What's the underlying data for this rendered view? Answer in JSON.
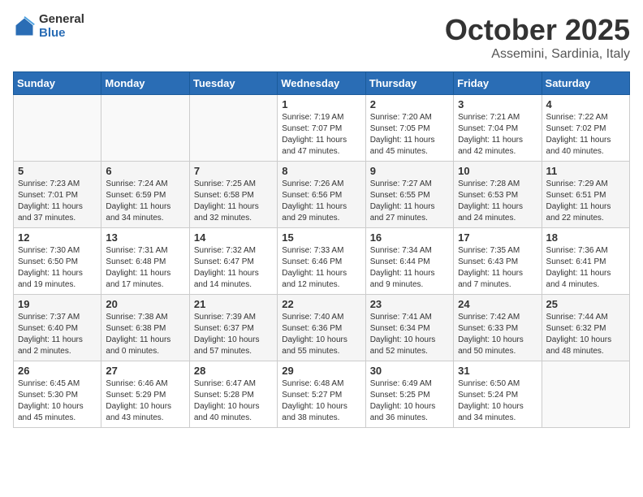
{
  "header": {
    "logo_general": "General",
    "logo_blue": "Blue",
    "month_title": "October 2025",
    "subtitle": "Assemini, Sardinia, Italy"
  },
  "weekdays": [
    "Sunday",
    "Monday",
    "Tuesday",
    "Wednesday",
    "Thursday",
    "Friday",
    "Saturday"
  ],
  "weeks": [
    [
      {
        "day": "",
        "info": ""
      },
      {
        "day": "",
        "info": ""
      },
      {
        "day": "",
        "info": ""
      },
      {
        "day": "1",
        "info": "Sunrise: 7:19 AM\nSunset: 7:07 PM\nDaylight: 11 hours and 47 minutes."
      },
      {
        "day": "2",
        "info": "Sunrise: 7:20 AM\nSunset: 7:05 PM\nDaylight: 11 hours and 45 minutes."
      },
      {
        "day": "3",
        "info": "Sunrise: 7:21 AM\nSunset: 7:04 PM\nDaylight: 11 hours and 42 minutes."
      },
      {
        "day": "4",
        "info": "Sunrise: 7:22 AM\nSunset: 7:02 PM\nDaylight: 11 hours and 40 minutes."
      }
    ],
    [
      {
        "day": "5",
        "info": "Sunrise: 7:23 AM\nSunset: 7:01 PM\nDaylight: 11 hours and 37 minutes."
      },
      {
        "day": "6",
        "info": "Sunrise: 7:24 AM\nSunset: 6:59 PM\nDaylight: 11 hours and 34 minutes."
      },
      {
        "day": "7",
        "info": "Sunrise: 7:25 AM\nSunset: 6:58 PM\nDaylight: 11 hours and 32 minutes."
      },
      {
        "day": "8",
        "info": "Sunrise: 7:26 AM\nSunset: 6:56 PM\nDaylight: 11 hours and 29 minutes."
      },
      {
        "day": "9",
        "info": "Sunrise: 7:27 AM\nSunset: 6:55 PM\nDaylight: 11 hours and 27 minutes."
      },
      {
        "day": "10",
        "info": "Sunrise: 7:28 AM\nSunset: 6:53 PM\nDaylight: 11 hours and 24 minutes."
      },
      {
        "day": "11",
        "info": "Sunrise: 7:29 AM\nSunset: 6:51 PM\nDaylight: 11 hours and 22 minutes."
      }
    ],
    [
      {
        "day": "12",
        "info": "Sunrise: 7:30 AM\nSunset: 6:50 PM\nDaylight: 11 hours and 19 minutes."
      },
      {
        "day": "13",
        "info": "Sunrise: 7:31 AM\nSunset: 6:48 PM\nDaylight: 11 hours and 17 minutes."
      },
      {
        "day": "14",
        "info": "Sunrise: 7:32 AM\nSunset: 6:47 PM\nDaylight: 11 hours and 14 minutes."
      },
      {
        "day": "15",
        "info": "Sunrise: 7:33 AM\nSunset: 6:46 PM\nDaylight: 11 hours and 12 minutes."
      },
      {
        "day": "16",
        "info": "Sunrise: 7:34 AM\nSunset: 6:44 PM\nDaylight: 11 hours and 9 minutes."
      },
      {
        "day": "17",
        "info": "Sunrise: 7:35 AM\nSunset: 6:43 PM\nDaylight: 11 hours and 7 minutes."
      },
      {
        "day": "18",
        "info": "Sunrise: 7:36 AM\nSunset: 6:41 PM\nDaylight: 11 hours and 4 minutes."
      }
    ],
    [
      {
        "day": "19",
        "info": "Sunrise: 7:37 AM\nSunset: 6:40 PM\nDaylight: 11 hours and 2 minutes."
      },
      {
        "day": "20",
        "info": "Sunrise: 7:38 AM\nSunset: 6:38 PM\nDaylight: 11 hours and 0 minutes."
      },
      {
        "day": "21",
        "info": "Sunrise: 7:39 AM\nSunset: 6:37 PM\nDaylight: 10 hours and 57 minutes."
      },
      {
        "day": "22",
        "info": "Sunrise: 7:40 AM\nSunset: 6:36 PM\nDaylight: 10 hours and 55 minutes."
      },
      {
        "day": "23",
        "info": "Sunrise: 7:41 AM\nSunset: 6:34 PM\nDaylight: 10 hours and 52 minutes."
      },
      {
        "day": "24",
        "info": "Sunrise: 7:42 AM\nSunset: 6:33 PM\nDaylight: 10 hours and 50 minutes."
      },
      {
        "day": "25",
        "info": "Sunrise: 7:44 AM\nSunset: 6:32 PM\nDaylight: 10 hours and 48 minutes."
      }
    ],
    [
      {
        "day": "26",
        "info": "Sunrise: 6:45 AM\nSunset: 5:30 PM\nDaylight: 10 hours and 45 minutes."
      },
      {
        "day": "27",
        "info": "Sunrise: 6:46 AM\nSunset: 5:29 PM\nDaylight: 10 hours and 43 minutes."
      },
      {
        "day": "28",
        "info": "Sunrise: 6:47 AM\nSunset: 5:28 PM\nDaylight: 10 hours and 40 minutes."
      },
      {
        "day": "29",
        "info": "Sunrise: 6:48 AM\nSunset: 5:27 PM\nDaylight: 10 hours and 38 minutes."
      },
      {
        "day": "30",
        "info": "Sunrise: 6:49 AM\nSunset: 5:25 PM\nDaylight: 10 hours and 36 minutes."
      },
      {
        "day": "31",
        "info": "Sunrise: 6:50 AM\nSunset: 5:24 PM\nDaylight: 10 hours and 34 minutes."
      },
      {
        "day": "",
        "info": ""
      }
    ]
  ]
}
